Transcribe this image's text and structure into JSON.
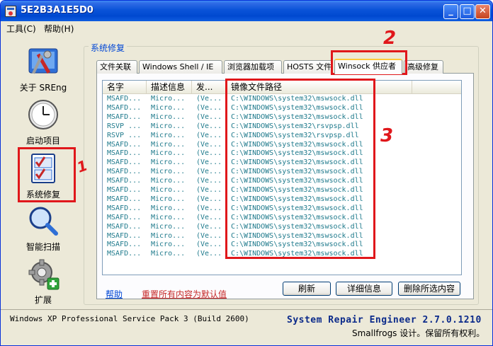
{
  "window": {
    "title": "5E2B3A1E5D0"
  },
  "titlebar_buttons": {
    "minimize": "_",
    "maximize": "□",
    "close": "✕"
  },
  "menu": [
    {
      "label": "工具(C)"
    },
    {
      "label": "帮助(H)"
    }
  ],
  "sidebar": {
    "items": [
      {
        "label": "关于 SREng",
        "icon": "tools-icon"
      },
      {
        "label": "启动项目",
        "icon": "clock-icon"
      },
      {
        "label": "系统修复",
        "icon": "checklist-icon",
        "selected": true
      },
      {
        "label": "智能扫描",
        "icon": "magnifier-icon"
      },
      {
        "label": "扩展",
        "icon": "gear-plus-icon"
      }
    ]
  },
  "group": {
    "title": "系统修复"
  },
  "tabs": [
    {
      "label": "文件关联"
    },
    {
      "label": "Windows Shell / IE"
    },
    {
      "label": "浏览器加载项"
    },
    {
      "label": "HOSTS 文件"
    },
    {
      "label": "Winsock 供应者",
      "active": true
    },
    {
      "label": "高级修复"
    }
  ],
  "table": {
    "columns": [
      "名字",
      "描述信息",
      "发...",
      "镜像文件路径"
    ],
    "rows": [
      [
        "MSAFD...",
        "Micro...",
        "(Ve...",
        "C:\\WINDOWS\\system32\\mswsock.dll"
      ],
      [
        "MSAFD...",
        "Micro...",
        "(Ve...",
        "C:\\WINDOWS\\system32\\mswsock.dll"
      ],
      [
        "MSAFD...",
        "Micro...",
        "(Ve...",
        "C:\\WINDOWS\\system32\\mswsock.dll"
      ],
      [
        "RSVP ...",
        "Micro...",
        "(Ve...",
        "C:\\WINDOWS\\system32\\rsvpsp.dll"
      ],
      [
        "RSVP ...",
        "Micro...",
        "(Ve...",
        "C:\\WINDOWS\\system32\\rsvpsp.dll"
      ],
      [
        "MSAFD...",
        "Micro...",
        "(Ve...",
        "C:\\WINDOWS\\system32\\mswsock.dll"
      ],
      [
        "MSAFD...",
        "Micro...",
        "(Ve...",
        "C:\\WINDOWS\\system32\\mswsock.dll"
      ],
      [
        "MSAFD...",
        "Micro...",
        "(Ve...",
        "C:\\WINDOWS\\system32\\mswsock.dll"
      ],
      [
        "MSAFD...",
        "Micro...",
        "(Ve...",
        "C:\\WINDOWS\\system32\\mswsock.dll"
      ],
      [
        "MSAFD...",
        "Micro...",
        "(Ve...",
        "C:\\WINDOWS\\system32\\mswsock.dll"
      ],
      [
        "MSAFD...",
        "Micro...",
        "(Ve...",
        "C:\\WINDOWS\\system32\\mswsock.dll"
      ],
      [
        "MSAFD...",
        "Micro...",
        "(Ve...",
        "C:\\WINDOWS\\system32\\mswsock.dll"
      ],
      [
        "MSAFD...",
        "Micro...",
        "(Ve...",
        "C:\\WINDOWS\\system32\\mswsock.dll"
      ],
      [
        "MSAFD...",
        "Micro...",
        "(Ve...",
        "C:\\WINDOWS\\system32\\mswsock.dll"
      ],
      [
        "MSAFD...",
        "Micro...",
        "(Ve...",
        "C:\\WINDOWS\\system32\\mswsock.dll"
      ],
      [
        "MSAFD...",
        "Micro...",
        "(Ve...",
        "C:\\WINDOWS\\system32\\mswsock.dll"
      ],
      [
        "MSAFD...",
        "Micro...",
        "(Ve...",
        "C:\\WINDOWS\\system32\\mswsock.dll"
      ],
      [
        "MSAFD...",
        "Micro...",
        "(Ve...",
        "C:\\WINDOWS\\system32\\mswsock.dll"
      ]
    ]
  },
  "actions": {
    "help_link": "帮助",
    "reset_link": "重置所有内容为默认值",
    "refresh_button": "刷新",
    "details_button": "详细信息",
    "delete_button": "删除所选内容"
  },
  "status": {
    "os": "Windows XP Professional Service Pack 3 (Build 2600)",
    "app": "System Repair Engineer 2.7.0.1210",
    "copyright": "Smallfrogs 设计。保留所有权利。"
  },
  "annotations": {
    "one": "1",
    "two": "2",
    "three": "3"
  },
  "colors": {
    "annotation": "#e0171b",
    "titlebar": "#0a53d8",
    "list_text": "#1f7a8c",
    "link": "#0046d5"
  }
}
